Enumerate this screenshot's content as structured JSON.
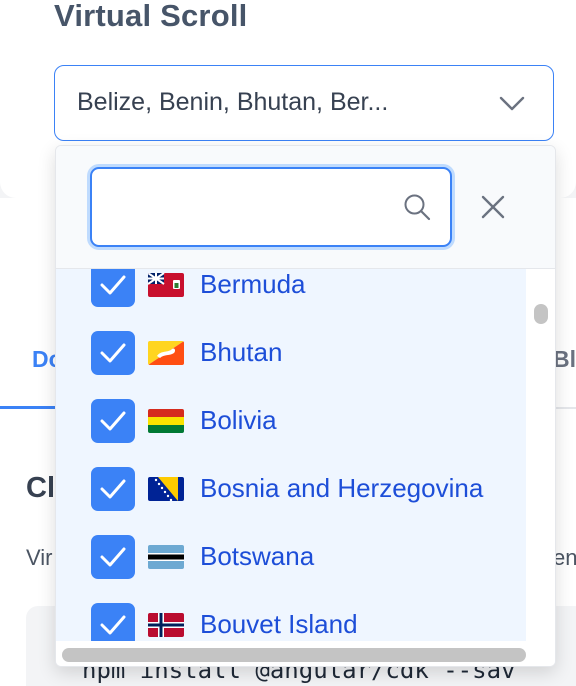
{
  "section": {
    "title": "Virtual Scroll"
  },
  "select": {
    "value": "Belize, Benin, Bhutan, Ber..."
  },
  "filter": {
    "value": "",
    "placeholder": ""
  },
  "options": [
    {
      "label": "Bermuda",
      "checked": true,
      "flag": "bermuda-flag"
    },
    {
      "label": "Bhutan",
      "checked": true,
      "flag": "bhutan-flag"
    },
    {
      "label": "Bolivia",
      "checked": true,
      "flag": "bolivia-flag"
    },
    {
      "label": "Bosnia and Herzegovina",
      "checked": true,
      "flag": "bosnia-flag"
    },
    {
      "label": "Botswana",
      "checked": true,
      "flag": "botswana-flag"
    },
    {
      "label": "Bouvet Island",
      "checked": true,
      "flag": "norway-flag"
    }
  ],
  "background": {
    "tab_left": "Do",
    "tab_right": "Bl",
    "heading": "Cl",
    "text_left": "Vir",
    "text_right": "en",
    "code": "npm install @angular/cdk --sav"
  },
  "colors": {
    "accent": "#3b82f6",
    "selected_text": "#1d4ed8",
    "selected_bg": "#eff6ff"
  }
}
